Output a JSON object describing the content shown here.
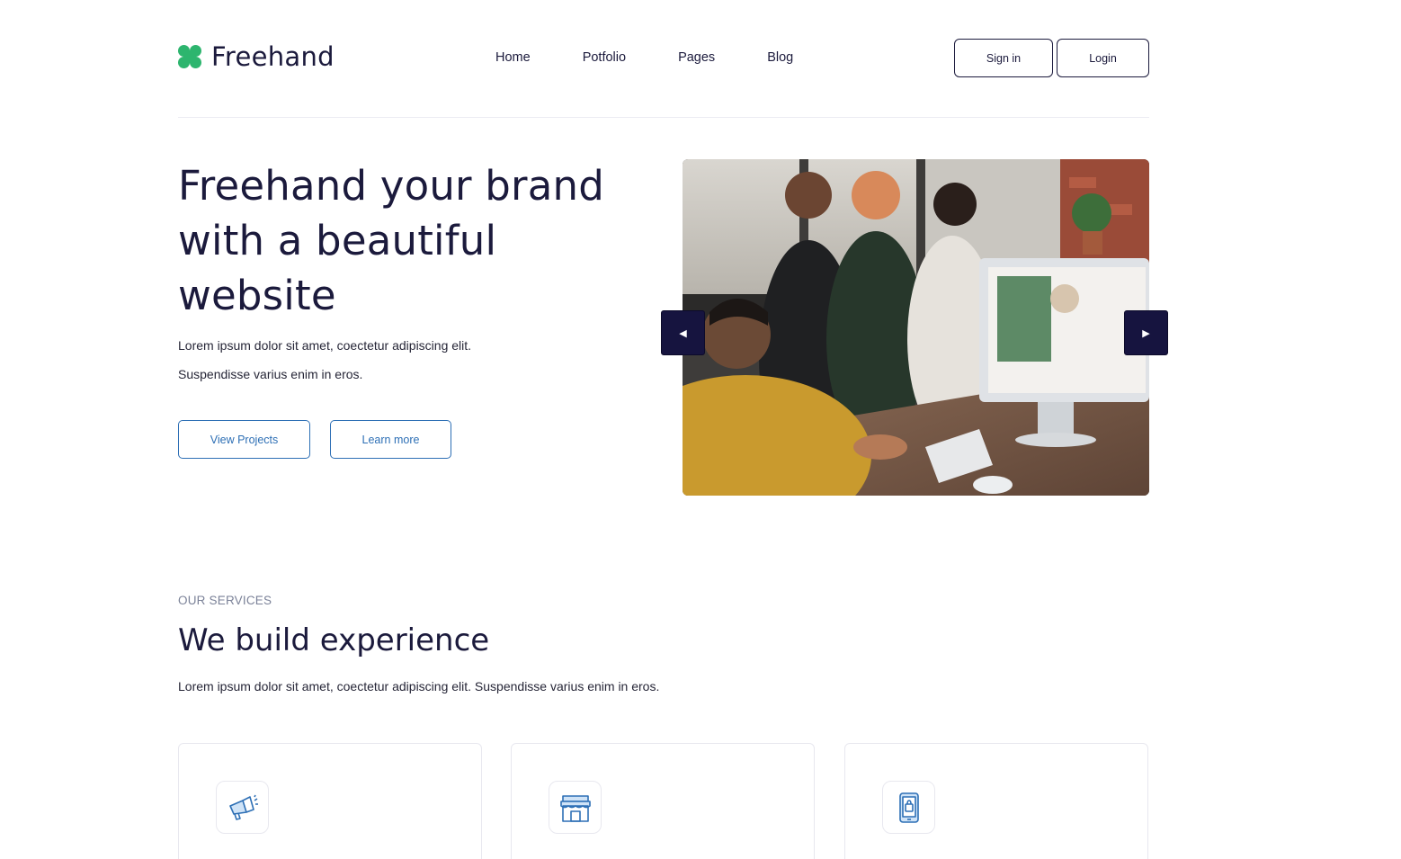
{
  "brand": {
    "name": "Freehand",
    "logo_color": "#2db56e"
  },
  "nav": {
    "items": [
      {
        "label": "Home"
      },
      {
        "label": "Potfolio"
      },
      {
        "label": "Pages"
      },
      {
        "label": "Blog"
      }
    ]
  },
  "auth": {
    "signin_label": "Sign in",
    "login_label": "Login"
  },
  "hero": {
    "title": "Freehand your brand with a beautiful website",
    "text_line1": "Lorem ipsum dolor sit amet, coectetur adipiscing elit.",
    "text_line2": "Suspendisse varius enim in eros.",
    "primary_button": "View Projects",
    "secondary_button": "Learn more",
    "button_color": "#2d6fb5"
  },
  "slider": {
    "prev_glyph": "◀",
    "next_glyph": "▶",
    "image": "office team meeting photo",
    "arrow_color": "#16143f"
  },
  "services": {
    "eyebrow": "OUR SERVICES",
    "title": "We build experience",
    "text": "Lorem ipsum dolor sit amet, coectetur adipiscing elit. Suspendisse varius enim in eros.",
    "cards": [
      {
        "icon": "megaphone-icon"
      },
      {
        "icon": "storefront-icon"
      },
      {
        "icon": "mobile-shopping-icon"
      }
    ]
  },
  "colors": {
    "text": "#1b1a3c",
    "accent_blue": "#2d6fb5",
    "border": "#e8e8ef"
  }
}
